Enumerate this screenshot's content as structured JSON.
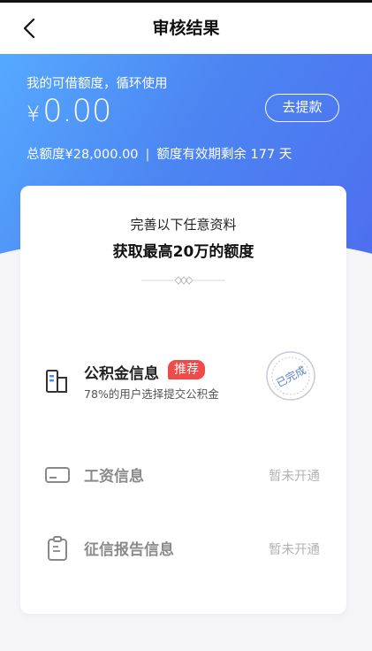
{
  "nav": {
    "title": "审核结果"
  },
  "hero": {
    "label": "我的可借额度，循环使用",
    "currency": "¥",
    "amount": "0.00",
    "withdraw_button": "去提款",
    "total_label": "总额度",
    "total_currency": "¥",
    "total_amount": "28,000.00",
    "separator": "|",
    "validity_text": "额度有效期剩余 177 天"
  },
  "card": {
    "subtitle": "完善以下任意资料",
    "title": "获取最高20万的额度",
    "items": [
      {
        "name": "公积金信息",
        "badge": "推荐",
        "desc": "78%的用户选择提交公积金",
        "stamp": "已完成"
      },
      {
        "name": "工资信息",
        "status": "暂未开通"
      },
      {
        "name": "征信报告信息",
        "status": "暂未开通"
      }
    ]
  },
  "colors": {
    "accent": "#4e8df5",
    "badge": "#f04a49",
    "stamp": "#5b7fc7"
  }
}
